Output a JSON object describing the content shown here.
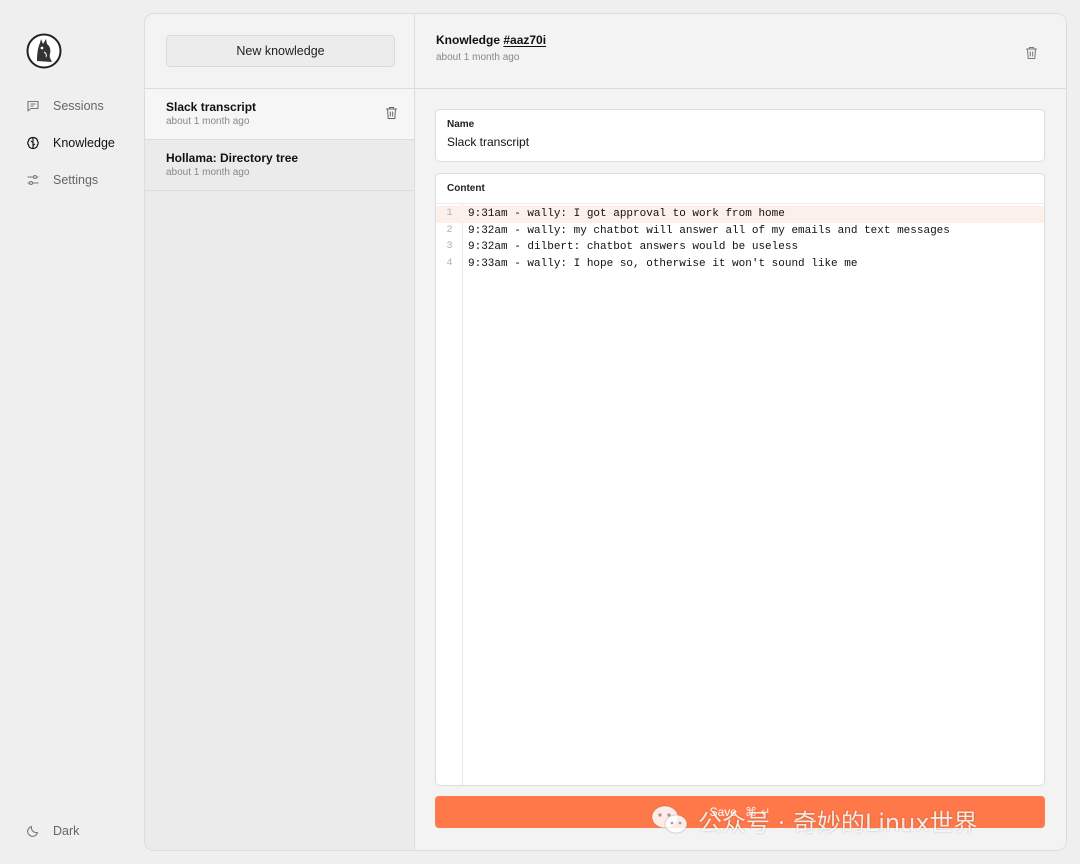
{
  "nav": {
    "items": [
      {
        "label": "Sessions",
        "icon": "chat-icon",
        "active": false
      },
      {
        "label": "Knowledge",
        "icon": "brain-icon",
        "active": true
      },
      {
        "label": "Settings",
        "icon": "sliders-icon",
        "active": false
      }
    ],
    "theme_label": "Dark"
  },
  "list": {
    "new_button_label": "New knowledge",
    "items": [
      {
        "title": "Slack transcript",
        "time": "about 1 month ago",
        "selected": true
      },
      {
        "title": "Hollama: Directory tree",
        "time": "about 1 month ago",
        "selected": false
      }
    ]
  },
  "detail": {
    "title_prefix": "Knowledge",
    "id": "#aaz70i",
    "time": "about 1 month ago",
    "name_label": "Name",
    "name_value": "Slack transcript",
    "content_label": "Content",
    "lines": [
      {
        "n": "1",
        "text": "9:31am - wally: I got approval to work from home"
      },
      {
        "n": "2",
        "text": "9:32am - wally: my chatbot will answer all of my emails and text messages"
      },
      {
        "n": "3",
        "text": "9:32am - dilbert: chatbot answers would be useless"
      },
      {
        "n": "4",
        "text": "9:33am - wally: I hope so, otherwise it won't sound like me"
      }
    ],
    "save_label": "Save",
    "save_shortcut": "⌘ ↵"
  },
  "watermark": "公众号 · 奇妙的Linux世界",
  "colors": {
    "accent": "#ff7849",
    "highlight_line": "#fdf0ea"
  }
}
